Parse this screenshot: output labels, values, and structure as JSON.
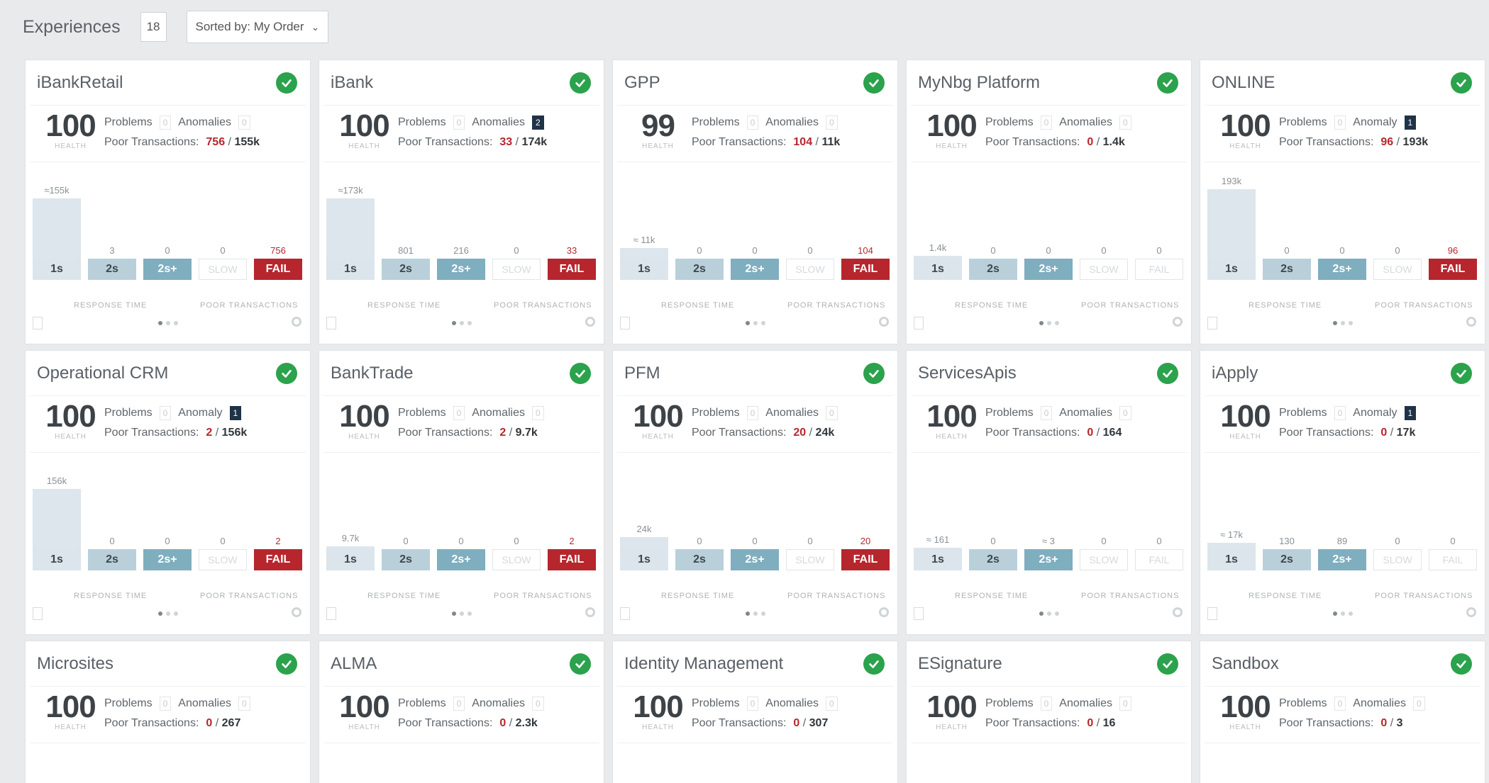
{
  "header": {
    "title": "Experiences",
    "count": "18",
    "sort_label": "Sorted by: My Order"
  },
  "colors": {
    "fail": "#b7262d",
    "health_ok": "#2ba24c",
    "badge_dark": "#1f3247"
  },
  "labels": {
    "health": "HEALTH",
    "problems": "Problems",
    "poor_tx": "Poor Transactions:",
    "response_time": "RESPONSE TIME",
    "poor_transactions": "POOR TRANSACTIONS",
    "b1": "1s",
    "b2": "2s",
    "b3": "2s+",
    "slow": "SLOW",
    "fail": "FAIL"
  },
  "cards": [
    {
      "name": "iBankRetail",
      "health": "100",
      "problems": "0",
      "anom_label": "Anomalies",
      "anomalies": "0",
      "anom_dark": false,
      "poor": "756",
      "total": "155k",
      "v1": "≈155k",
      "v2": "3",
      "v3": "0",
      "vslow": "0",
      "vfail": "756",
      "h1": 1.0,
      "fail_on": true,
      "show_chart": true
    },
    {
      "name": "iBank",
      "health": "100",
      "problems": "0",
      "anom_label": "Anomalies",
      "anomalies": "2",
      "anom_dark": true,
      "poor": "33",
      "total": "174k",
      "v1": "≈173k",
      "v2": "801",
      "v3": "216",
      "vslow": "0",
      "vfail": "33",
      "h1": 1.0,
      "fail_on": true,
      "show_chart": true
    },
    {
      "name": "GPP",
      "health": "99",
      "problems": "0",
      "anom_label": "Anomalies",
      "anomalies": "0",
      "anom_dark": false,
      "poor": "104",
      "total": "11k",
      "v1": "≈ 11k",
      "v2": "0",
      "v3": "0",
      "vslow": "0",
      "vfail": "104",
      "h1": 0.18,
      "fail_on": true,
      "show_chart": true
    },
    {
      "name": "MyNbg Platform",
      "health": "100",
      "problems": "0",
      "anom_label": "Anomalies",
      "anomalies": "0",
      "anom_dark": false,
      "poor": "0",
      "total": "1.4k",
      "v1": "1.4k",
      "v2": "0",
      "v3": "0",
      "vslow": "0",
      "vfail": "0",
      "h1": 0.05,
      "fail_on": false,
      "show_chart": true
    },
    {
      "name": "ONLINE",
      "health": "100",
      "problems": "0",
      "anom_label": "Anomaly",
      "anomalies": "1",
      "anom_dark": true,
      "poor": "96",
      "total": "193k",
      "v1": "193k",
      "v2": "0",
      "v3": "0",
      "vslow": "0",
      "vfail": "96",
      "h1": 1.15,
      "fail_on": true,
      "show_chart": true
    },
    {
      "name": "Operational CRM",
      "health": "100",
      "problems": "0",
      "anom_label": "Anomaly",
      "anomalies": "1",
      "anom_dark": true,
      "poor": "2",
      "total": "156k",
      "v1": "156k",
      "v2": "0",
      "v3": "0",
      "vslow": "0",
      "vfail": "2",
      "h1": 1.0,
      "fail_on": true,
      "show_chart": true
    },
    {
      "name": "BankTrade",
      "health": "100",
      "problems": "0",
      "anom_label": "Anomalies",
      "anomalies": "0",
      "anom_dark": false,
      "poor": "2",
      "total": "9.7k",
      "v1": "9.7k",
      "v2": "0",
      "v3": "0",
      "vslow": "0",
      "vfail": "2",
      "h1": 0.05,
      "fail_on": true,
      "show_chart": true
    },
    {
      "name": "PFM",
      "health": "100",
      "problems": "0",
      "anom_label": "Anomalies",
      "anomalies": "0",
      "anom_dark": false,
      "poor": "20",
      "total": "24k",
      "v1": "24k",
      "v2": "0",
      "v3": "0",
      "vslow": "0",
      "vfail": "20",
      "h1": 0.2,
      "fail_on": true,
      "show_chart": true
    },
    {
      "name": "ServicesApis",
      "health": "100",
      "problems": "0",
      "anom_label": "Anomalies",
      "anomalies": "0",
      "anom_dark": false,
      "poor": "0",
      "total": "164",
      "v1": "≈ 161",
      "v2": "0",
      "v3": "≈ 3",
      "vslow": "0",
      "vfail": "0",
      "h1": 0.02,
      "fail_on": false,
      "show_chart": true
    },
    {
      "name": "iApply",
      "health": "100",
      "problems": "0",
      "anom_label": "Anomaly",
      "anomalies": "1",
      "anom_dark": true,
      "poor": "0",
      "total": "17k",
      "v1": "≈ 17k",
      "v2": "130",
      "v3": "89",
      "vslow": "0",
      "vfail": "0",
      "h1": 0.1,
      "fail_on": false,
      "show_chart": true
    },
    {
      "name": "Microsites",
      "health": "100",
      "problems": "0",
      "anom_label": "Anomalies",
      "anomalies": "0",
      "anom_dark": false,
      "poor": "0",
      "total": "267",
      "show_chart": false
    },
    {
      "name": "ALMA",
      "health": "100",
      "problems": "0",
      "anom_label": "Anomalies",
      "anomalies": "0",
      "anom_dark": false,
      "poor": "0",
      "total": "2.3k",
      "show_chart": false
    },
    {
      "name": "Identity Management",
      "health": "100",
      "problems": "0",
      "anom_label": "Anomalies",
      "anomalies": "0",
      "anom_dark": false,
      "poor": "0",
      "total": "307",
      "show_chart": false
    },
    {
      "name": "ESignature",
      "health": "100",
      "problems": "0",
      "anom_label": "Anomalies",
      "anomalies": "0",
      "anom_dark": false,
      "poor": "0",
      "total": "16",
      "show_chart": false
    },
    {
      "name": "Sandbox",
      "health": "100",
      "problems": "0",
      "anom_label": "Anomalies",
      "anomalies": "0",
      "anom_dark": false,
      "poor": "0",
      "total": "3",
      "show_chart": false
    }
  ]
}
